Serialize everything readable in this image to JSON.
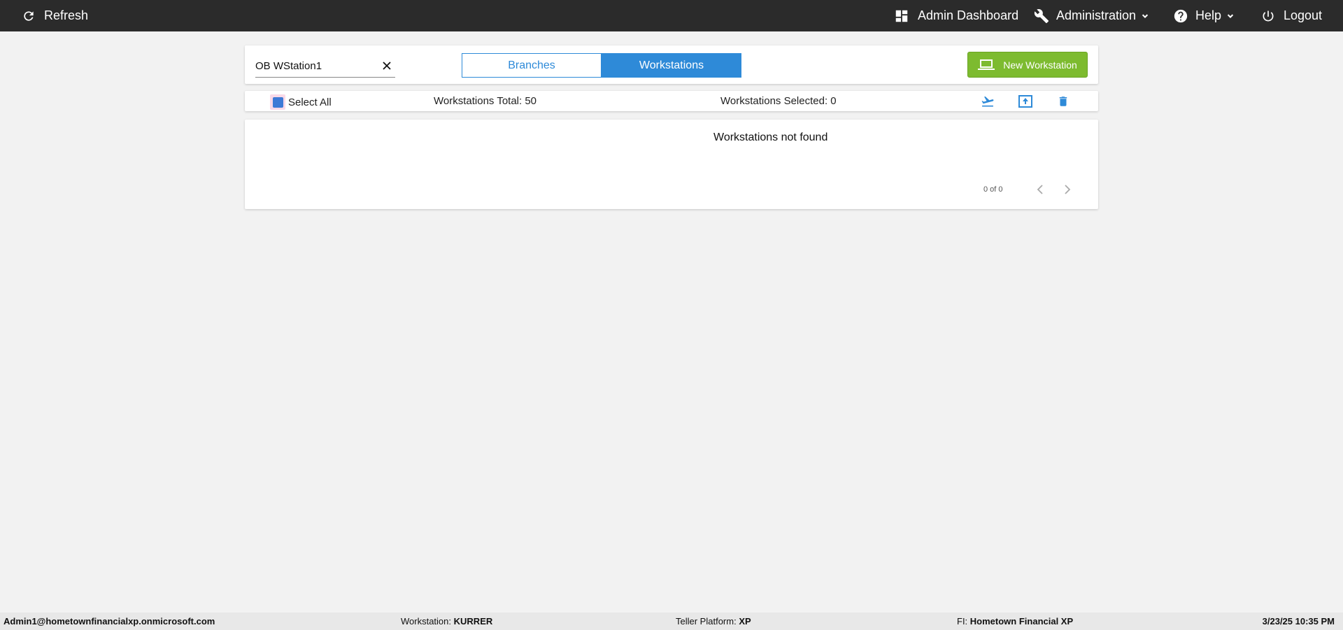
{
  "topbar": {
    "refresh_label": "Refresh",
    "admin_dashboard_label": "Admin Dashboard",
    "administration_label": "Administration",
    "help_label": "Help",
    "logout_label": "Logout"
  },
  "toolbar": {
    "search_value": "OB WStation1",
    "tabs": [
      {
        "label": "Branches",
        "active": false
      },
      {
        "label": "Workstations",
        "active": true
      }
    ],
    "new_button_label": "New Workstation"
  },
  "selection": {
    "select_all_label": "Select All",
    "total_text": "Workstations Total: 50",
    "selected_text": "Workstations Selected: 0"
  },
  "results": {
    "empty_message": "Workstations not found",
    "pager_text": "0 of 0"
  },
  "statusbar": {
    "user": "Admin1@hometownfinancialxp.onmicrosoft.com",
    "workstation_label": "Workstation:",
    "workstation_value": "KURRER",
    "teller_platform_label": "Teller Platform:",
    "teller_platform_value": "XP",
    "fi_label": "FI:",
    "fi_value": "Hometown Financial XP",
    "datetime": "3/23/25 10:35 PM"
  },
  "colors": {
    "topbar_bg": "#2b2b2b",
    "accent_blue": "#2e8ad8",
    "new_button_green": "#7dbb2f",
    "background": "#f2f2f2"
  },
  "icons": [
    "refresh-icon",
    "dashboard-icon",
    "wrench-icon",
    "help-circle-icon",
    "power-icon",
    "laptop-icon",
    "airplane-takeoff-icon",
    "upload-icon",
    "trash-icon",
    "close-icon",
    "chevron-left-icon",
    "chevron-right-icon"
  ]
}
